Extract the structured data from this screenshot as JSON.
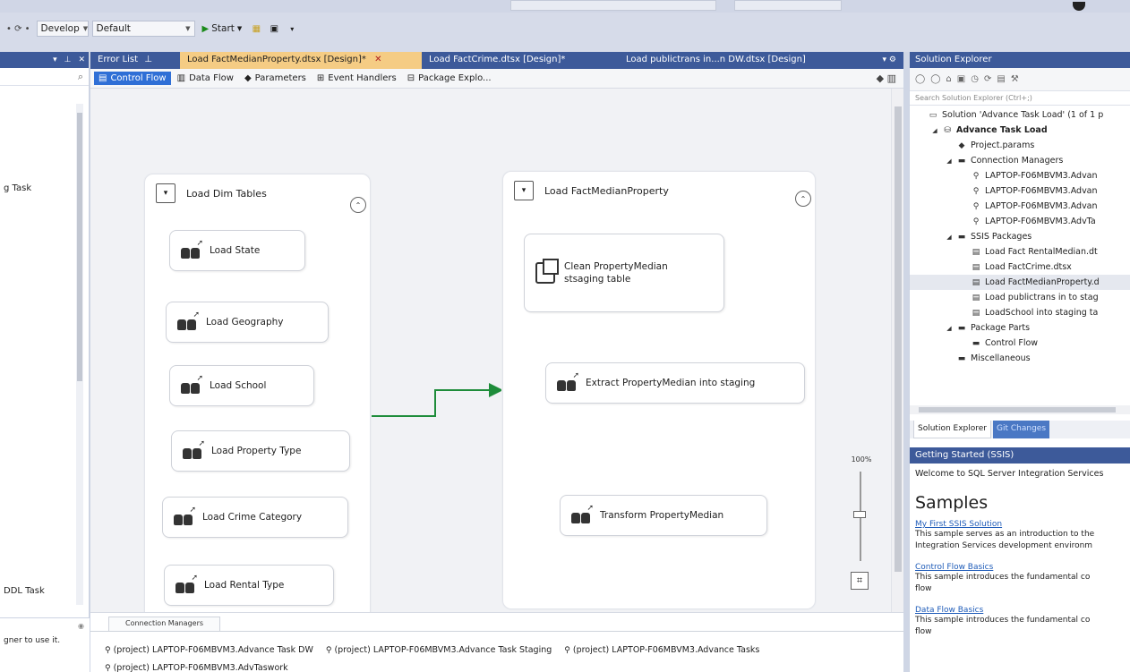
{
  "toolbar": {
    "config_combo": "Develop",
    "platform_combo": "Default",
    "start_label": "Start"
  },
  "left_panel": {
    "item1": "g Task",
    "item2": "DDL Task",
    "hint": "gner to use it."
  },
  "doc_tabs": [
    {
      "label": "Error List"
    },
    {
      "label": "Load FactMedianProperty.dtsx [Design]*",
      "active": true
    },
    {
      "label": "Load FactCrime.dtsx [Design]*"
    },
    {
      "label": "Load publictrans in...n DW.dtsx [Design]"
    }
  ],
  "designer_tabs": [
    {
      "label": "Control Flow",
      "active": true
    },
    {
      "label": "Data Flow"
    },
    {
      "label": "Parameters"
    },
    {
      "label": "Event Handlers"
    },
    {
      "label": "Package Explo..."
    }
  ],
  "containers": {
    "dim": {
      "title": "Load Dim Tables",
      "tasks": [
        "Load State",
        "Load Geography",
        "Load School",
        "Load Property Type",
        "Load Crime Category",
        "Load Rental Type"
      ]
    },
    "fact": {
      "title": "Load FactMedianProperty",
      "tasks": [
        "Clean PropertyMedian stsaging table",
        "Extract PropertyMedian into staging",
        "Transform PropertyMedian"
      ]
    }
  },
  "zoom": {
    "label": "100%"
  },
  "connection_managers": {
    "tab": "Connection Managers",
    "items": [
      "(project) LAPTOP-F06MBVM3.Advance Task DW",
      "(project) LAPTOP-F06MBVM3.Advance Task Staging",
      "(project) LAPTOP-F06MBVM3.Advance Tasks",
      "(project) LAPTOP-F06MBVM3.AdvTaswork"
    ]
  },
  "solution_explorer": {
    "title": "Solution Explorer",
    "search_placeholder": "Search Solution Explorer (Ctrl+;)",
    "tree": [
      {
        "label": "Solution 'Advance Task Load' (1 of 1 p",
        "level": 0,
        "icon": "solution-icon"
      },
      {
        "label": "Advance Task Load",
        "level": 1,
        "bold": true,
        "expanded": true,
        "icon": "project-icon"
      },
      {
        "label": "Project.params",
        "level": 2,
        "icon": "params-icon"
      },
      {
        "label": "Connection Managers",
        "level": 2,
        "expanded": true,
        "icon": "folder-icon"
      },
      {
        "label": "LAPTOP-F06MBVM3.Advan",
        "level": 3,
        "icon": "plug-icon"
      },
      {
        "label": "LAPTOP-F06MBVM3.Advan",
        "level": 3,
        "icon": "plug-icon"
      },
      {
        "label": "LAPTOP-F06MBVM3.Advan",
        "level": 3,
        "icon": "plug-icon"
      },
      {
        "label": "LAPTOP-F06MBVM3.AdvTa",
        "level": 3,
        "icon": "plug-icon"
      },
      {
        "label": "SSIS Packages",
        "level": 2,
        "expanded": true,
        "icon": "folder-icon"
      },
      {
        "label": "Load Fact RentalMedian.dt",
        "level": 3,
        "icon": "package-icon"
      },
      {
        "label": "Load FactCrime.dtsx",
        "level": 3,
        "icon": "package-icon"
      },
      {
        "label": "Load FactMedianProperty.d",
        "level": 3,
        "icon": "package-icon",
        "selected": true
      },
      {
        "label": "Load publictrans in to stag",
        "level": 3,
        "icon": "package-icon"
      },
      {
        "label": "LoadSchool into staging ta",
        "level": 3,
        "icon": "package-icon"
      },
      {
        "label": "Package Parts",
        "level": 2,
        "expanded": true,
        "icon": "folder-icon"
      },
      {
        "label": "Control Flow",
        "level": 3,
        "icon": "folder-icon"
      },
      {
        "label": "Miscellaneous",
        "level": 2,
        "icon": "folder-icon"
      }
    ],
    "bottom_tabs": [
      "Solution Explorer",
      "Git Changes"
    ]
  },
  "getting_started": {
    "title": "Getting Started (SSIS)",
    "welcome": "Welcome to SQL Server Integration Services",
    "samples_heading": "Samples",
    "items": [
      {
        "link": "My First SSIS Solution",
        "desc": [
          "This sample serves as an introduction to the",
          "Integration Services development environm"
        ]
      },
      {
        "link": "Control Flow Basics",
        "desc": [
          "This sample introduces the fundamental co",
          "flow"
        ]
      },
      {
        "link": "Data Flow Basics",
        "desc": [
          "This sample introduces the fundamental co",
          "flow"
        ]
      }
    ]
  },
  "colors": {
    "accent": "#3d5a9a",
    "active_tab": "#f5cc84",
    "precedence_arrow": "#1e8c3a"
  }
}
